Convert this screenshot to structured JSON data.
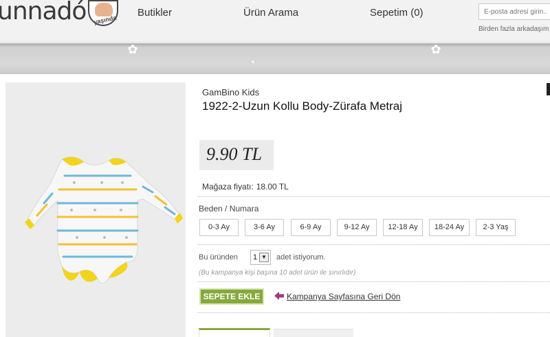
{
  "header": {
    "logo_text": "unnadó",
    "logo_sub": "yaşında",
    "nav": {
      "butikler": "Butikler",
      "urun_arama": "Ürün Arama",
      "sepetim": "Sepetim (0)"
    },
    "email_placeholder": "E-posta adresi girin..",
    "email_note": "Birden fazla arkadaşım"
  },
  "product": {
    "brand": "GamBino Kids",
    "title": "1922-2-Uzun Kollu Body-Zürafa Metraj",
    "price": "9.90 TL",
    "store_price_label": "Mağaza fiyatı:",
    "store_price_value": "18.00 TL",
    "size_label": "Beden / Numara",
    "sizes": [
      "0-3 Ay",
      "3-6 Ay",
      "6-9 Ay",
      "9-12 Ay",
      "12-18 Ay",
      "18-24 Ay",
      "2-3 Yaş"
    ],
    "quantity_prefix": "Bu üründen",
    "quantity_value": "1",
    "quantity_suffix": "adet istiyorum.",
    "limit_note": "(Bu kampanya kişi başına 10 adet ürün ile sınırlıdır)",
    "add_to_cart": "SEPETE EKLE",
    "back_link": "Kampanya Sayfasına Geri Dön"
  },
  "colors": {
    "accent_green": "#86a83c",
    "back_arrow": "#9c3d7a",
    "body_yellow": "#f2d31d"
  },
  "icons": {
    "back_arrow": "arrow-left-icon",
    "qty_dropdown": "chevron-down-icon"
  }
}
